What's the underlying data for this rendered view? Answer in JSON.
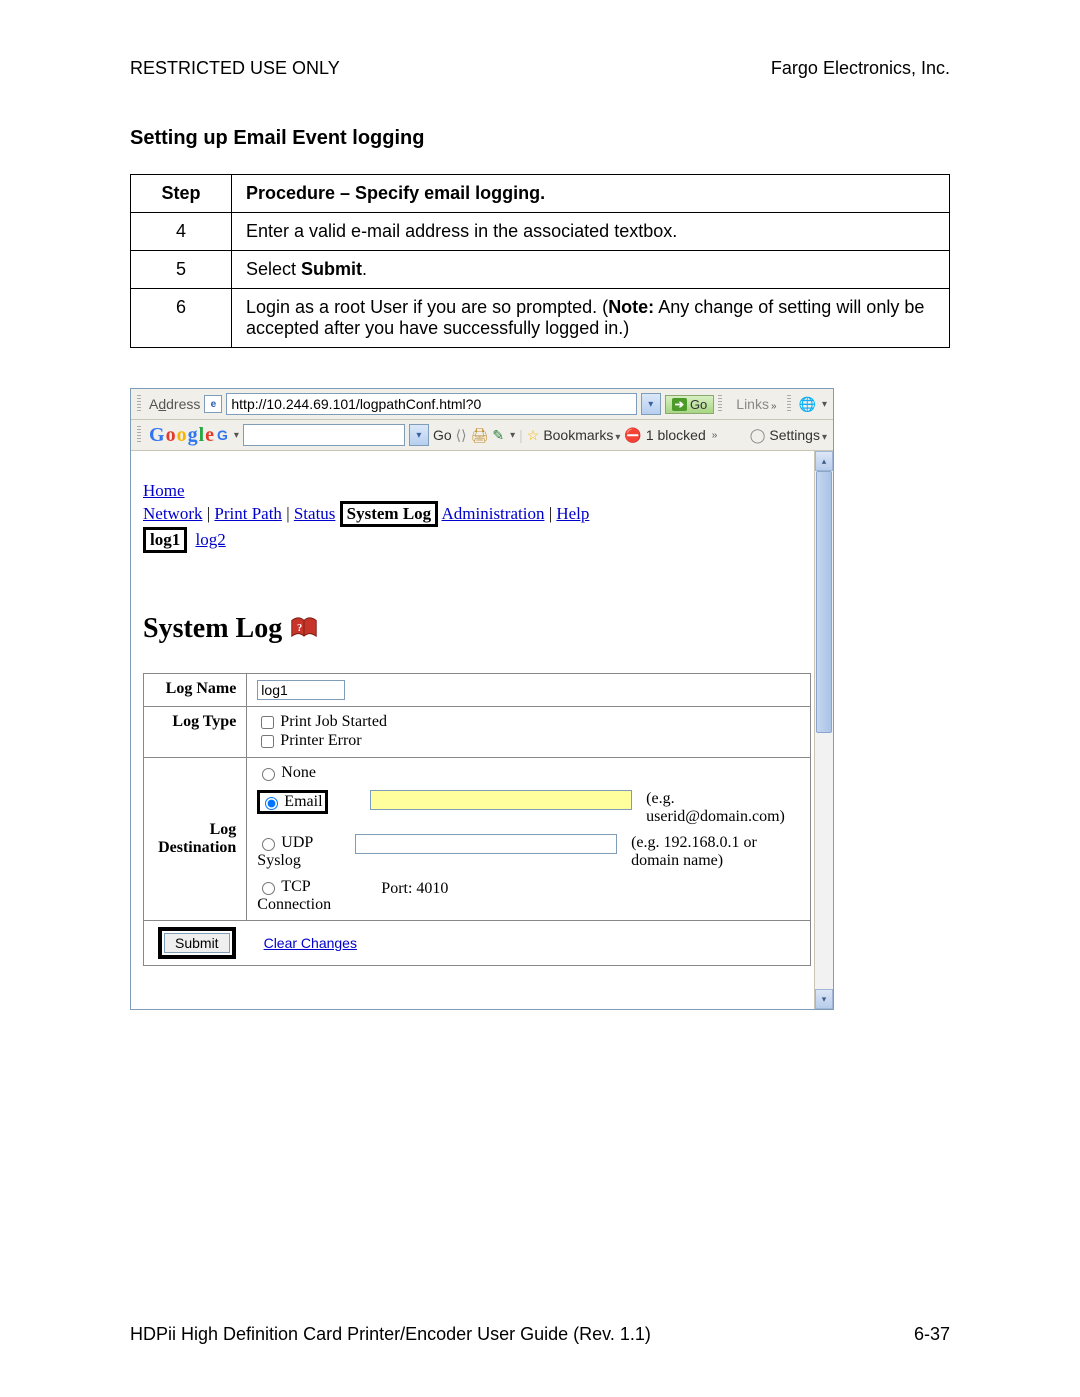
{
  "header": {
    "left": "RESTRICTED USE ONLY",
    "right": "Fargo Electronics, Inc."
  },
  "section_title": "Setting up Email Event logging",
  "proc": {
    "head_step": "Step",
    "head_proc": "Procedure – Specify email logging.",
    "rows": [
      {
        "step": "4",
        "text": "Enter a valid e-mail address in the associated textbox."
      },
      {
        "step": "5",
        "prefix": "Select ",
        "bold": "Submit",
        "suffix": "."
      },
      {
        "step": "6",
        "prefix": "Login as a root User if you are so prompted. (",
        "bold": "Note:",
        "suffix": "  Any change of setting will only be accepted after you have successfully logged in.)"
      }
    ]
  },
  "ie": {
    "address_label_pre": "A",
    "address_label_accel": "d",
    "address_label_post": "dress",
    "url": "http://10.244.69.101/logpathConf.html?0",
    "go_label": "Go",
    "links_label": "Links",
    "settings_label": "Settings",
    "goog_go": "Go",
    "bookmarks": "Bookmarks",
    "blocked": "1 blocked"
  },
  "nav": {
    "home": "Home",
    "items": [
      "Network",
      "Print Path",
      "Status"
    ],
    "selected": "System Log",
    "after": [
      "Administration",
      "Help"
    ],
    "sub_selected": "log1",
    "sub_other": "log2"
  },
  "syslog": {
    "heading": "System Log",
    "row_logname_label": "Log Name",
    "logname_value": "log1",
    "row_logtype_label": "Log Type",
    "logtype_opts": [
      "Print Job Started",
      "Printer Error"
    ],
    "row_dest_label": "Log Destination",
    "dest": {
      "none": "None",
      "email": "Email",
      "email_hint": "(e.g. userid@domain.com)",
      "udp": "UDP Syslog",
      "udp_hint": "(e.g. 192.168.0.1 or domain name)",
      "tcp": "TCP Connection",
      "port_label": "Port: 4010"
    },
    "submit": "Submit",
    "clear": "Clear Changes"
  },
  "footer": {
    "left": "HDPii High Definition Card Printer/Encoder User Guide (Rev. 1.1)",
    "right": "6-37"
  }
}
